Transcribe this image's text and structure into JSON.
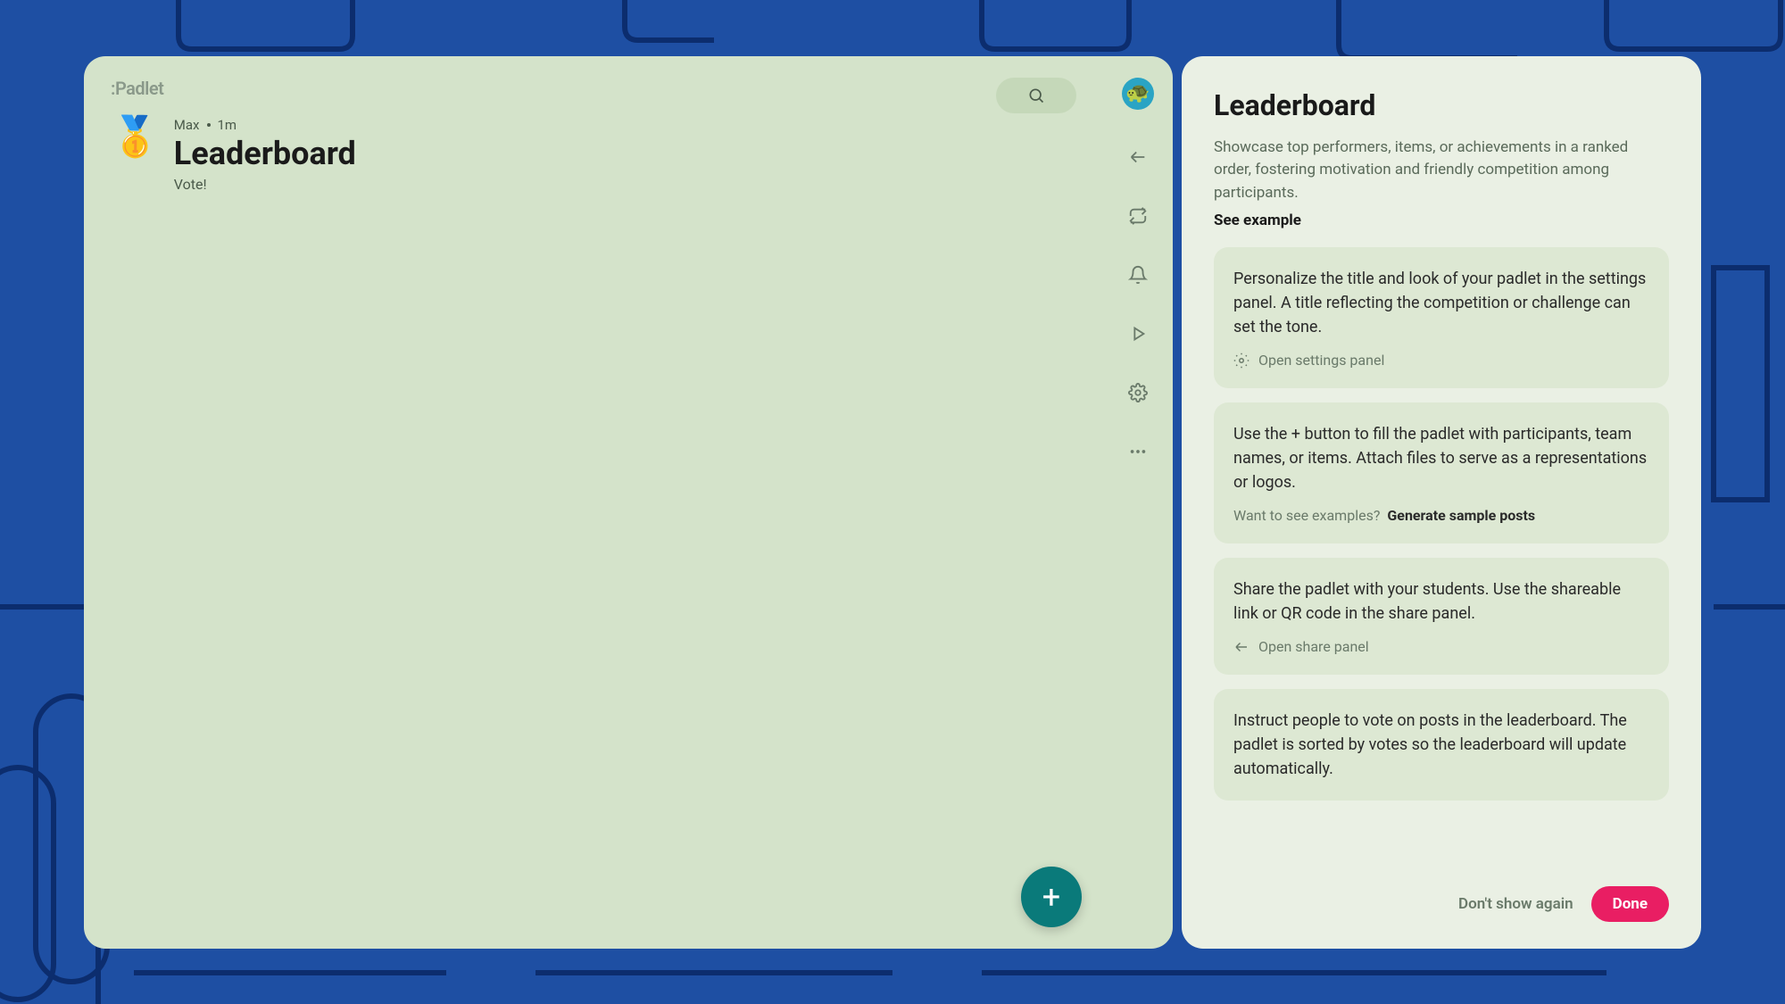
{
  "logo": ":Padlet",
  "board": {
    "author": "Max",
    "time": "1m",
    "title": "Leaderboard",
    "subtitle": "Vote!",
    "medal_emoji": "🥇"
  },
  "panel": {
    "title": "Leaderboard",
    "description": "Showcase top performers, items, or achievements in a ranked order, fostering motivation and friendly competition among participants.",
    "see_example": "See example",
    "tips": [
      {
        "text": "Personalize the title and look of your padlet in the settings panel. A title reflecting the competition or challenge can set the tone.",
        "action_label": "Open settings panel"
      },
      {
        "text": "Use the + button to fill the padlet with participants, team names, or items. Attach files to serve as a representations or logos.",
        "prompt": "Want to see examples?",
        "action_bold": "Generate sample posts"
      },
      {
        "text": "Share the padlet with your students. Use the shareable link or QR code in the share panel.",
        "action_label": "Open share panel"
      },
      {
        "text": "Instruct people to vote on posts in the leaderboard. The padlet is sorted by votes so the leaderboard will update automatically."
      }
    ],
    "footer": {
      "dont_show": "Don't show again",
      "done": "Done"
    }
  }
}
